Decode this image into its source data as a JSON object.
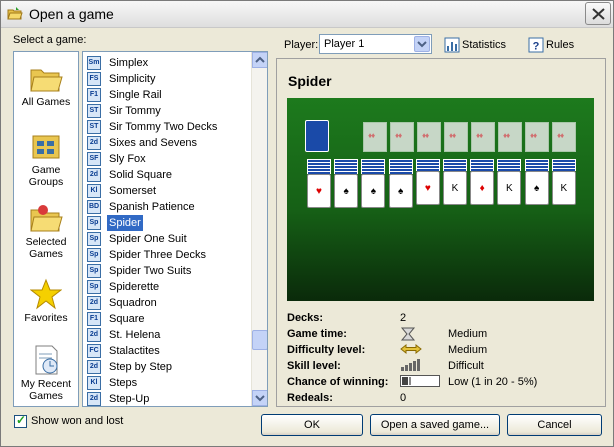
{
  "window": {
    "title": "Open a game",
    "close_icon": "close-icon",
    "title_icon": "folder-open-icon"
  },
  "left": {
    "select_label": "Select a game:",
    "categories": [
      {
        "label": "All Games",
        "icon": "folder-icon"
      },
      {
        "label": "Game Groups",
        "icon": "game-groups-icon"
      },
      {
        "label": "Selected Games",
        "icon": "selected-folder-icon"
      },
      {
        "label": "Favorites",
        "icon": "star-icon"
      },
      {
        "label": "My Recent Games",
        "icon": "recent-doc-icon"
      }
    ],
    "games": [
      {
        "badge": "Sm",
        "name": "Simplex"
      },
      {
        "badge": "FS",
        "name": "Simplicity"
      },
      {
        "badge": "F1",
        "name": "Single Rail"
      },
      {
        "badge": "ST",
        "name": "Sir Tommy"
      },
      {
        "badge": "ST",
        "name": "Sir Tommy Two Decks"
      },
      {
        "badge": "2d",
        "name": "Sixes and Sevens"
      },
      {
        "badge": "SF",
        "name": "Sly Fox"
      },
      {
        "badge": "2d",
        "name": "Solid Square"
      },
      {
        "badge": "Kl",
        "name": "Somerset"
      },
      {
        "badge": "BD",
        "name": "Spanish Patience"
      },
      {
        "badge": "Sp",
        "name": "Spider",
        "selected": true
      },
      {
        "badge": "Sp",
        "name": "Spider One Suit"
      },
      {
        "badge": "Sp",
        "name": "Spider Three Decks"
      },
      {
        "badge": "Sp",
        "name": "Spider Two Suits"
      },
      {
        "badge": "Sp",
        "name": "Spiderette"
      },
      {
        "badge": "2d",
        "name": "Squadron"
      },
      {
        "badge": "F1",
        "name": "Square"
      },
      {
        "badge": "2d",
        "name": "St. Helena"
      },
      {
        "badge": "FC",
        "name": "Stalactites"
      },
      {
        "badge": "2d",
        "name": "Step by Step"
      },
      {
        "badge": "Kl",
        "name": "Steps"
      },
      {
        "badge": "2d",
        "name": "Step-Up"
      }
    ],
    "show_won_lost": "Show won and lost"
  },
  "toolbar": {
    "player_label": "Player:",
    "player_value": "Player 1",
    "statistics": "Statistics",
    "rules": "Rules"
  },
  "game": {
    "title": "Spider",
    "stats": [
      {
        "key": "Decks:",
        "value": "2",
        "icon": ""
      },
      {
        "key": "Game time:",
        "value": "Medium",
        "icon": "hourglass-icon"
      },
      {
        "key": "Difficulty level:",
        "value": "Medium",
        "icon": "double-arrow-icon"
      },
      {
        "key": "Skill level:",
        "value": "Difficult",
        "icon": "skill-bars-icon"
      },
      {
        "key": "Chance of winning:",
        "value": "Low (1 in 20  -  5%)",
        "icon": "chance-meter-icon"
      },
      {
        "key": "Redeals:",
        "value": "0",
        "icon": ""
      }
    ]
  },
  "buttons": {
    "ok": "OK",
    "open_saved": "Open a saved game...",
    "cancel": "Cancel"
  },
  "colors": {
    "selection": "#316ac5",
    "felt": "#1d7a1d",
    "card_back": "#1a4aa8"
  }
}
